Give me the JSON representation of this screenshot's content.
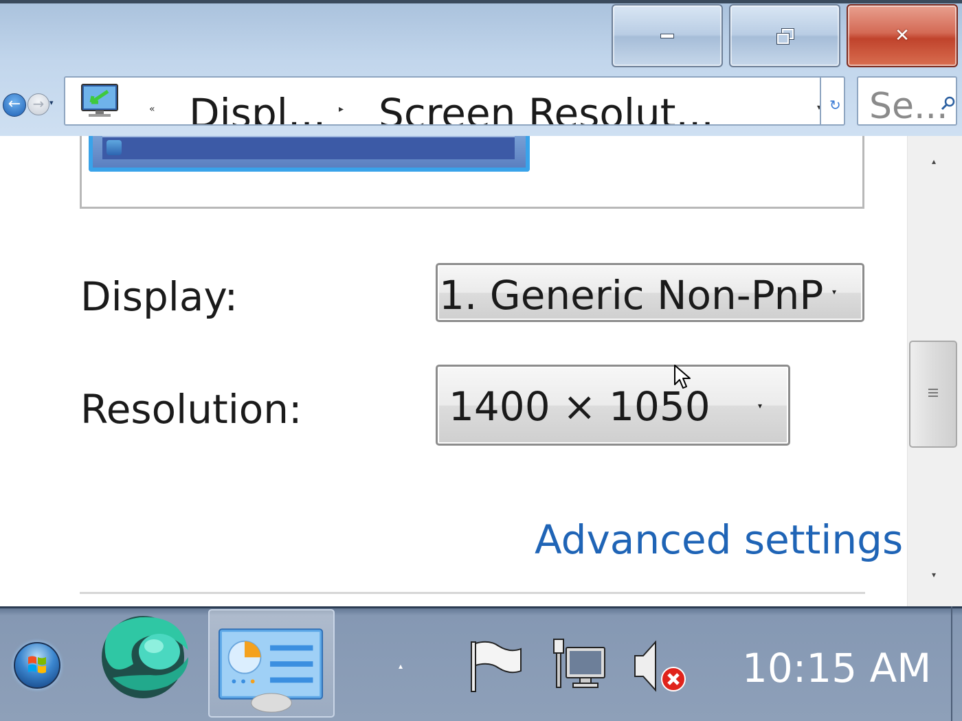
{
  "window": {
    "title_buttons": {
      "minimize": "minimize-icon",
      "restore": "restore-icon",
      "close": "close-icon"
    }
  },
  "address_bar": {
    "overflow_chevron": "«",
    "crumbs": [
      "Displ...",
      "Screen Resolut..."
    ],
    "separator": "▸",
    "dropdown": "▾",
    "refresh": "↻"
  },
  "search": {
    "placeholder": "Se..."
  },
  "settings": {
    "display_label": "Display:",
    "display_value": "1. Generic Non-PnP",
    "resolution_label": "Resolution:",
    "resolution_value": "1400 × 1050",
    "combo_arrow": "▾",
    "advanced_link": "Advanced settings"
  },
  "scrollbar": {
    "up": "▴",
    "down": "▾"
  },
  "taskbar": {
    "tray_expand": "▴",
    "clock": "10:15 AM",
    "icons": [
      "start-orb",
      "app-swirl-icon",
      "control-panel-icon",
      "action-center-flag-icon",
      "network-icon",
      "volume-muted-icon"
    ]
  },
  "colors": {
    "link": "#1f64b6",
    "close_button": "#c0432c",
    "accent": "#39a3ea"
  }
}
